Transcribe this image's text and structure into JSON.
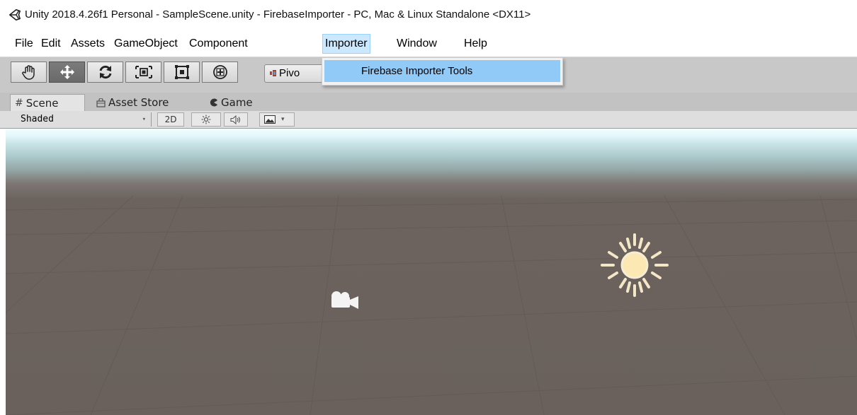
{
  "window": {
    "title": "Unity 2018.4.26f1 Personal - SampleScene.unity - FirebaseImporter - PC, Mac & Linux Standalone <DX11>",
    "logo_icon": "unity-logo-icon"
  },
  "menubar": {
    "items": [
      {
        "label": "File"
      },
      {
        "label": "Edit"
      },
      {
        "label": "Assets"
      },
      {
        "label": "GameObject"
      },
      {
        "label": "Component"
      },
      {
        "label": "Importer",
        "active": true
      },
      {
        "label": "Window"
      },
      {
        "label": "Help"
      }
    ]
  },
  "importer_menu": {
    "items": [
      {
        "label": "Firebase Importer Tools",
        "highlighted": true
      }
    ]
  },
  "toolbar": {
    "tools": [
      {
        "name": "hand-tool",
        "icon": "hand-icon"
      },
      {
        "name": "move-tool",
        "icon": "move-arrows-icon",
        "selected": true
      },
      {
        "name": "rotate-tool",
        "icon": "rotate-icon"
      },
      {
        "name": "scale-tool",
        "icon": "scale-icon"
      },
      {
        "name": "rect-tool",
        "icon": "rect-icon"
      },
      {
        "name": "transform-tool",
        "icon": "transform-icon"
      }
    ],
    "pivot_label": "Pivo"
  },
  "tabs": [
    {
      "label": "Scene",
      "icon": "grid-hash-icon",
      "glyph": "#",
      "active": true
    },
    {
      "label": "Asset Store",
      "icon": "shopping-bag-icon",
      "glyph": "🛍"
    },
    {
      "label": "Game",
      "icon": "pacman-icon",
      "glyph": "◖"
    }
  ],
  "scene_toolbar": {
    "shading_mode": "Shaded",
    "mode_2d_label": "2D",
    "lighting_icon": "sun-toggle-icon",
    "audio_icon": "speaker-icon",
    "effects_icon": "image-effects-icon"
  },
  "viewport": {
    "objects": [
      {
        "type": "directional-light",
        "icon": "sun-icon"
      },
      {
        "type": "camera",
        "icon": "camera-icon"
      }
    ],
    "colors": {
      "sky": "#e4f7fa",
      "ground": "#6a615c"
    }
  },
  "colors": {
    "menu_active_bg": "#cce8ff",
    "dropdown_highlight": "#91c9f7",
    "toolbar_bg": "#c8c8c8",
    "tool_selected": "#6e6e6e"
  }
}
